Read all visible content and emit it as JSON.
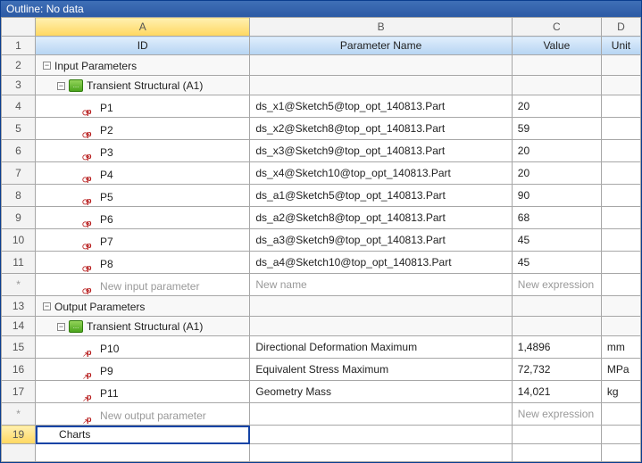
{
  "titlebar": "Outline: No data",
  "columns": {
    "letters": [
      "A",
      "B",
      "C",
      "D"
    ],
    "names": [
      "ID",
      "Parameter Name",
      "Value",
      "Unit"
    ]
  },
  "rows": {
    "r2_label": "Input Parameters",
    "r3_label": "Transient Structural (A1)",
    "params_in": [
      {
        "rn": "4",
        "id": "P1",
        "name": "ds_x1@Sketch5@top_opt_140813.Part",
        "value": "20",
        "unit": ""
      },
      {
        "rn": "5",
        "id": "P2",
        "name": "ds_x2@Sketch8@top_opt_140813.Part",
        "value": "59",
        "unit": ""
      },
      {
        "rn": "6",
        "id": "P3",
        "name": "ds_x3@Sketch9@top_opt_140813.Part",
        "value": "20",
        "unit": ""
      },
      {
        "rn": "7",
        "id": "P4",
        "name": "ds_x4@Sketch10@top_opt_140813.Part",
        "value": "20",
        "unit": ""
      },
      {
        "rn": "8",
        "id": "P5",
        "name": "ds_a1@Sketch5@top_opt_140813.Part",
        "value": "90",
        "unit": ""
      },
      {
        "rn": "9",
        "id": "P6",
        "name": "ds_a2@Sketch8@top_opt_140813.Part",
        "value": "68",
        "unit": ""
      },
      {
        "rn": "10",
        "id": "P7",
        "name": "ds_a3@Sketch9@top_opt_140813.Part",
        "value": "45",
        "unit": ""
      },
      {
        "rn": "11",
        "id": "P8",
        "name": "ds_a4@Sketch10@top_opt_140813.Part",
        "value": "45",
        "unit": ""
      }
    ],
    "in_placeholder": {
      "rn": "*",
      "id": "New input parameter",
      "name": "New name",
      "value": "New expression",
      "unit": ""
    },
    "r13_label": "Output Parameters",
    "r14_label": "Transient Structural (A1)",
    "params_out": [
      {
        "rn": "15",
        "id": "P10",
        "name": "Directional Deformation Maximum",
        "value": "1,4896",
        "unit": "mm"
      },
      {
        "rn": "16",
        "id": "P9",
        "name": "Equivalent Stress Maximum",
        "value": "72,732",
        "unit": "MPa"
      },
      {
        "rn": "17",
        "id": "P11",
        "name": "Geometry Mass",
        "value": "14,021",
        "unit": "kg"
      }
    ],
    "out_placeholder": {
      "rn": "*",
      "id": "New output parameter",
      "name": "",
      "value": "New expression",
      "unit": ""
    },
    "r19_label": "Charts",
    "r19_rn": "19"
  },
  "exp_minus": "−",
  "sys_icon_text": "…"
}
